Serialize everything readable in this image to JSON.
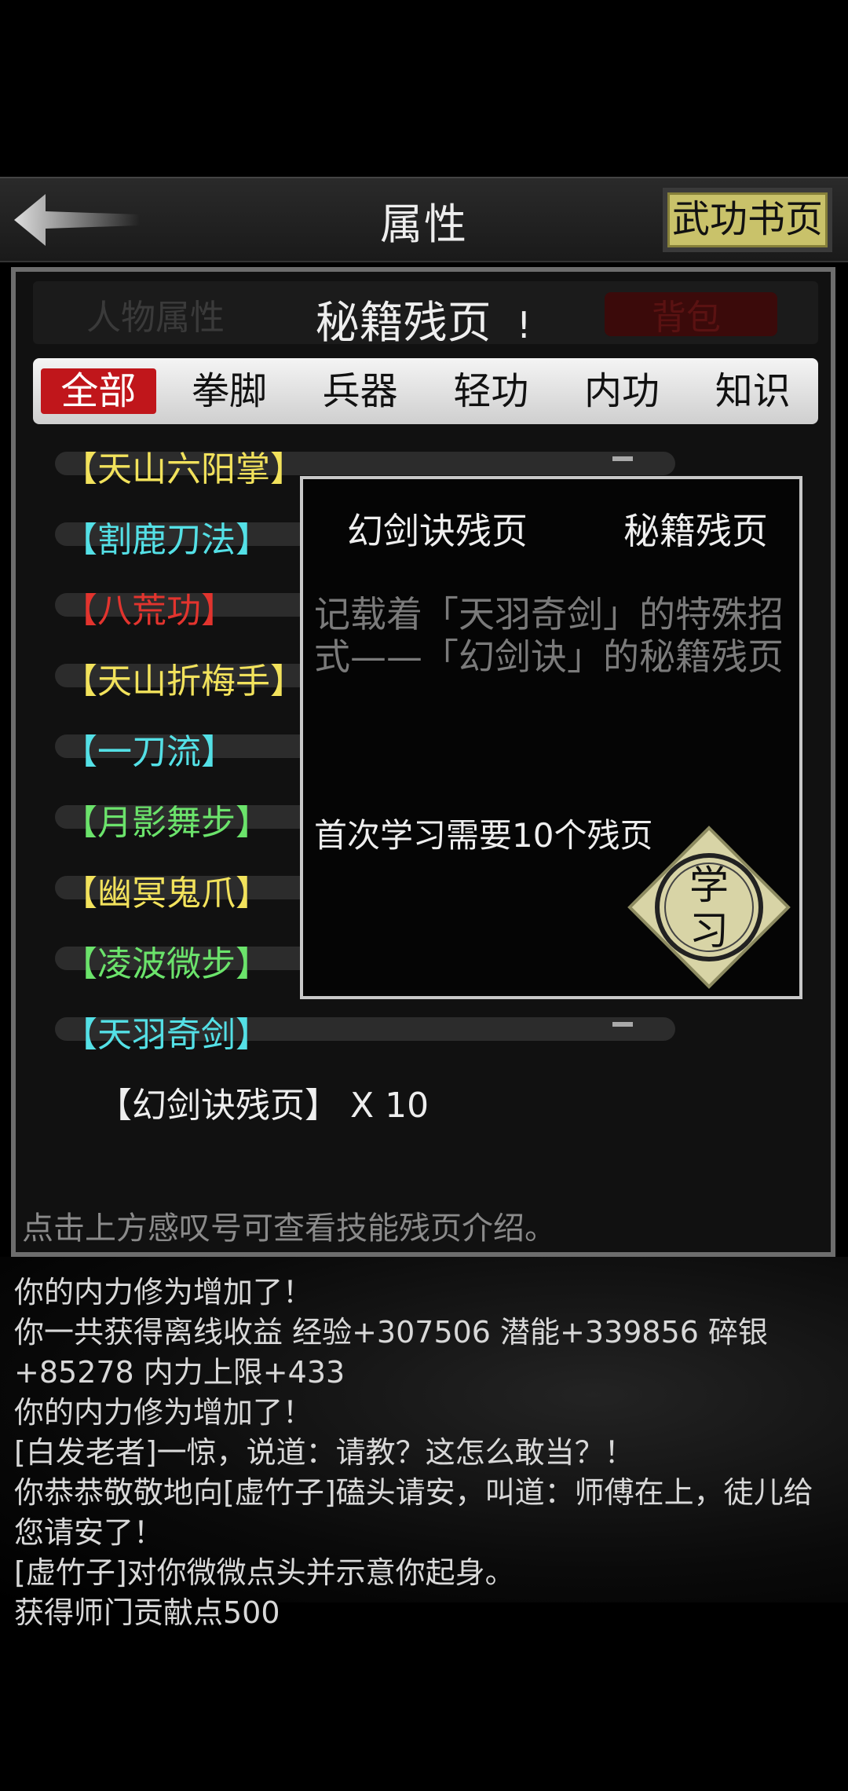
{
  "header": {
    "title": "属性",
    "book_button": "武功书页"
  },
  "panel": {
    "background_tabs": [
      "人物属性",
      "背包"
    ],
    "section_title": "秘籍残页",
    "categories": [
      "全部",
      "拳脚",
      "兵器",
      "轻功",
      "内功",
      "知识"
    ],
    "skills": [
      {
        "label": "【天山六阳掌】",
        "color": "#f2e25c"
      },
      {
        "label": "【割鹿刀法】",
        "color": "#54e0e6"
      },
      {
        "label": "【八荒功】",
        "color": "#e2342e"
      },
      {
        "label": "【天山折梅手】",
        "color": "#f2e25c"
      },
      {
        "label": "【一刀流】",
        "color": "#54e0e6"
      },
      {
        "label": "【月影舞步】",
        "color": "#6be36b"
      },
      {
        "label": "【幽冥鬼爪】",
        "color": "#f2e25c"
      },
      {
        "label": "【凌波微步】",
        "color": "#6be36b"
      },
      {
        "label": "【天羽奇剑】",
        "color": "#54e0e6"
      }
    ],
    "item_row": "【幻剑诀残页】  X 10",
    "hint": "点击上方感叹号可查看技能残页介绍。"
  },
  "detail": {
    "name": "幻剑诀残页",
    "type": "秘籍残页",
    "description": "记载着「天羽奇剑」的特殊招式——「幻剑诀」的秘籍残页",
    "requirement": "首次学习需要10个残页",
    "learn_button": "学习"
  },
  "log": [
    "你的内力修为增加了！",
    "你一共获得离线收益 经验+307506 潜能+339856 碎银+85278 内力上限+433",
    "你的内力修为增加了！",
    "[白发老者]一惊，说道：请教？这怎么敢当？！",
    "你恭恭敬敬地向[虚竹子]磕头请安，叫道：师傅在上，徒儿给您请安了！",
    "[虚竹子]对你微微点头并示意你起身。",
    "获得师门贡献点500"
  ]
}
